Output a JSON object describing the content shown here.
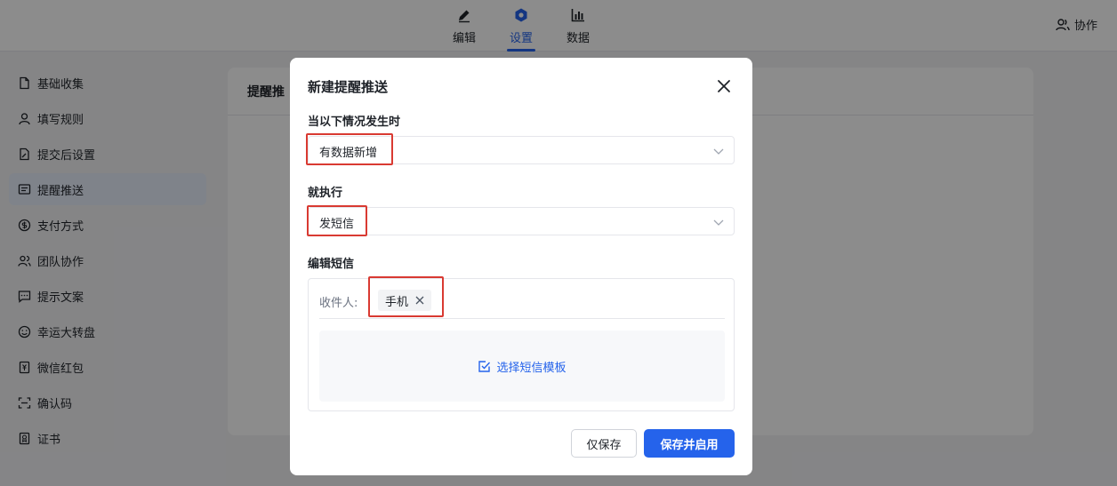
{
  "nav": {
    "tabs": [
      {
        "label": "编辑",
        "icon": "edit-icon"
      },
      {
        "label": "设置",
        "icon": "settings-icon",
        "active": true
      },
      {
        "label": "数据",
        "icon": "chart-icon"
      }
    ],
    "collab_label": "协作"
  },
  "sidebar": {
    "items": [
      {
        "label": "基础收集",
        "icon": "file-icon"
      },
      {
        "label": "填写规则",
        "icon": "user-icon"
      },
      {
        "label": "提交后设置",
        "icon": "file-edit-icon"
      },
      {
        "label": "提醒推送",
        "icon": "message-icon",
        "active": true
      },
      {
        "label": "支付方式",
        "icon": "dollar-icon"
      },
      {
        "label": "团队协作",
        "icon": "team-icon"
      },
      {
        "label": "提示文案",
        "icon": "comment-icon"
      },
      {
        "label": "幸运大转盘",
        "icon": "smile-icon"
      },
      {
        "label": "微信红包",
        "icon": "yuan-icon"
      },
      {
        "label": "确认码",
        "icon": "scan-icon"
      },
      {
        "label": "证书",
        "icon": "certificate-icon"
      }
    ]
  },
  "main": {
    "title": "提醒推"
  },
  "dialog": {
    "title": "新建提醒推送",
    "trigger_label": "当以下情况发生时",
    "trigger_value": "有数据新增",
    "action_label": "就执行",
    "action_value": "发短信",
    "sms_label": "编辑短信",
    "recipient_label": "收件人:",
    "recipient_chip": "手机",
    "template_link": "选择短信模板",
    "save_only": "仅保存",
    "save_enable": "保存并启用"
  },
  "colors": {
    "accent": "#2563eb",
    "highlight": "#d93a32"
  }
}
